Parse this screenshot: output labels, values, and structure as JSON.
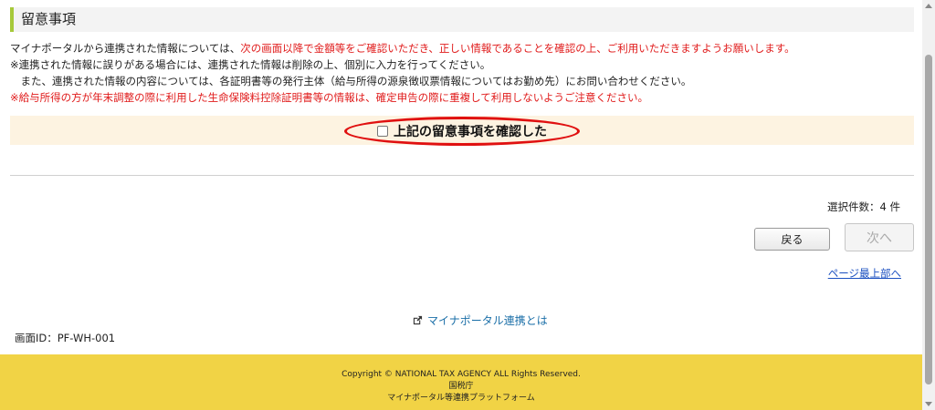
{
  "section": {
    "title": "留意事項"
  },
  "notes": {
    "line1_black": "マイナポータルから連携された情報については、",
    "line1_red": "次の画面以降で金額等をご確認いただき、正しい情報であることを確認の上、ご利用いただきますようお願いします。",
    "line2": "※連携された情報に誤りがある場合には、連携された情報は削除の上、個別に入力を行ってください。",
    "line3": "　また、連携された情報の内容については、各証明書等の発行主体（給与所得の源泉徴収票情報についてはお勤め先）にお問い合わせください。",
    "line4": "※給与所得の方が年末調整の際に利用した生命保険料控除証明書等の情報は、確定申告の際に重複して利用しないようご注意ください。"
  },
  "confirm": {
    "label": "上記の留意事項を確認した",
    "checked": false
  },
  "selection": {
    "count_text": "選択件数：4 件"
  },
  "buttons": {
    "back": "戻る",
    "next": "次へ"
  },
  "links": {
    "page_top": "ページ最上部へ",
    "mynaportal": "マイナポータル連携とは"
  },
  "screen_id": "画面ID：PF-WH-001",
  "footer": {
    "copyright": "Copyright © NATIONAL TAX AGENCY ALL Rights Reserved.",
    "agency": "国税庁",
    "platform": "マイナポータル等連携プラットフォーム"
  },
  "colors": {
    "accent_green": "#a6c93a",
    "warning_red": "#e01b1b",
    "footer_yellow": "#f1d345",
    "confirm_bg": "#fdf3e1"
  }
}
